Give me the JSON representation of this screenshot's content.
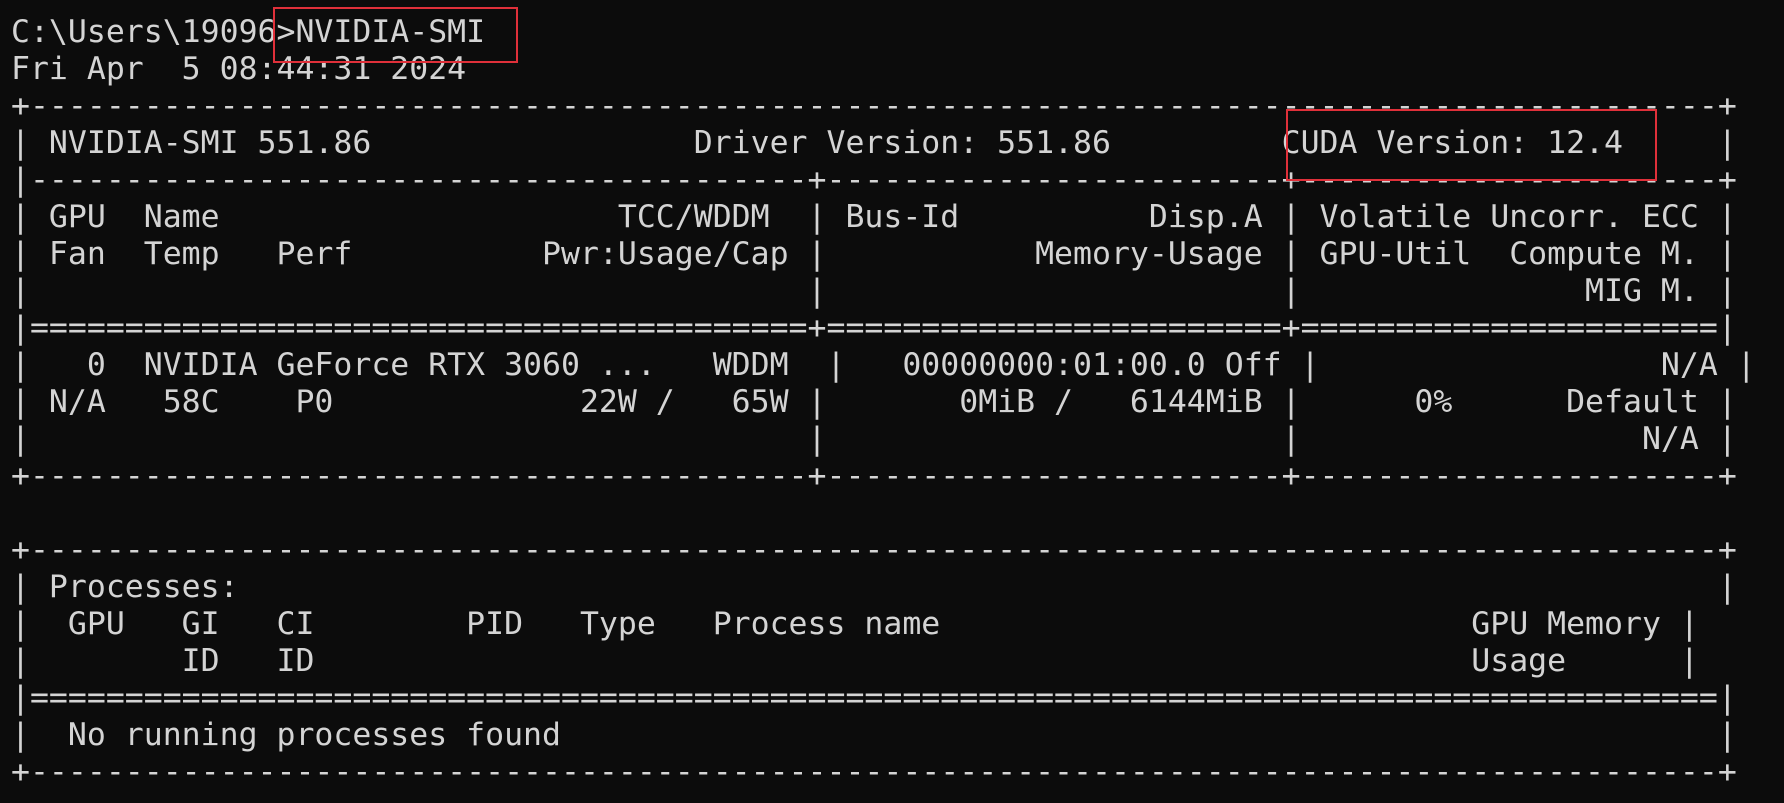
{
  "terminal": {
    "lines": [
      "C:\\Users\\19096>NVIDIA-SMI",
      "Fri Apr  5 08:44:31 2024",
      "+-----------------------------------------------------------------------------------------+",
      "| NVIDIA-SMI 551.86                 Driver Version: 551.86         CUDA Version: 12.4     |",
      "|-----------------------------------------+------------------------+----------------------+",
      "| GPU  Name                     TCC/WDDM  | Bus-Id          Disp.A | Volatile Uncorr. ECC |",
      "| Fan  Temp   Perf          Pwr:Usage/Cap |           Memory-Usage | GPU-Util  Compute M. |",
      "|                                         |                        |               MIG M. |",
      "|=========================================+========================+======================|",
      "|   0  NVIDIA GeForce RTX 3060 ...   WDDM  |   00000000:01:00.0 Off |                  N/A |",
      "| N/A   58C    P0             22W /   65W |       0MiB /   6144MiB |      0%      Default |",
      "|                                         |                        |                  N/A |",
      "+-----------------------------------------+------------------------+----------------------+",
      "",
      "+-----------------------------------------------------------------------------------------+",
      "| Processes:                                                                              |",
      "|  GPU   GI   CI        PID   Type   Process name                            GPU Memory |",
      "|        ID   ID                                                             Usage      |",
      "|=========================================================================================|",
      "|  No running processes found                                                             |",
      "+-----------------------------------------------------------------------------------------+"
    ]
  },
  "colors": {
    "background": "#0c0c0c",
    "text": "#d4d4d4",
    "highlight": "#e0303a"
  }
}
